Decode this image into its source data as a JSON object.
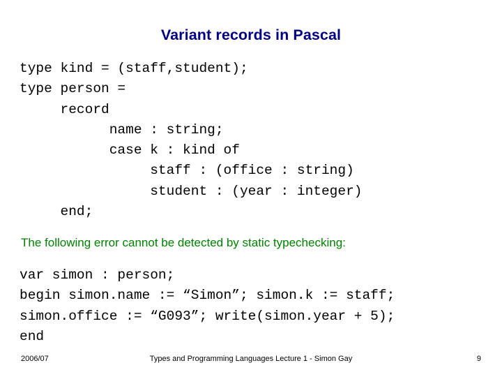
{
  "slide": {
    "title": "Variant records in Pascal",
    "code_top": "type kind = (staff,student);\ntype person =\n     record\n           name : string;\n           case k : kind of\n                staff : (office : string)\n                student : (year : integer)\n     end;",
    "note": "The following error cannot be detected by static typechecking:",
    "code_bottom": "var simon : person;\nbegin simon.name := “Simon”; simon.k := staff;\nsimon.office := “G093”; write(simon.year + 5);\nend",
    "footer": {
      "date": "2006/07",
      "center": "Types and Programming Languages Lecture 1 - Simon Gay",
      "page": "9"
    },
    "colors": {
      "title": "#000080",
      "note": "#008000",
      "code": "#000000"
    }
  }
}
